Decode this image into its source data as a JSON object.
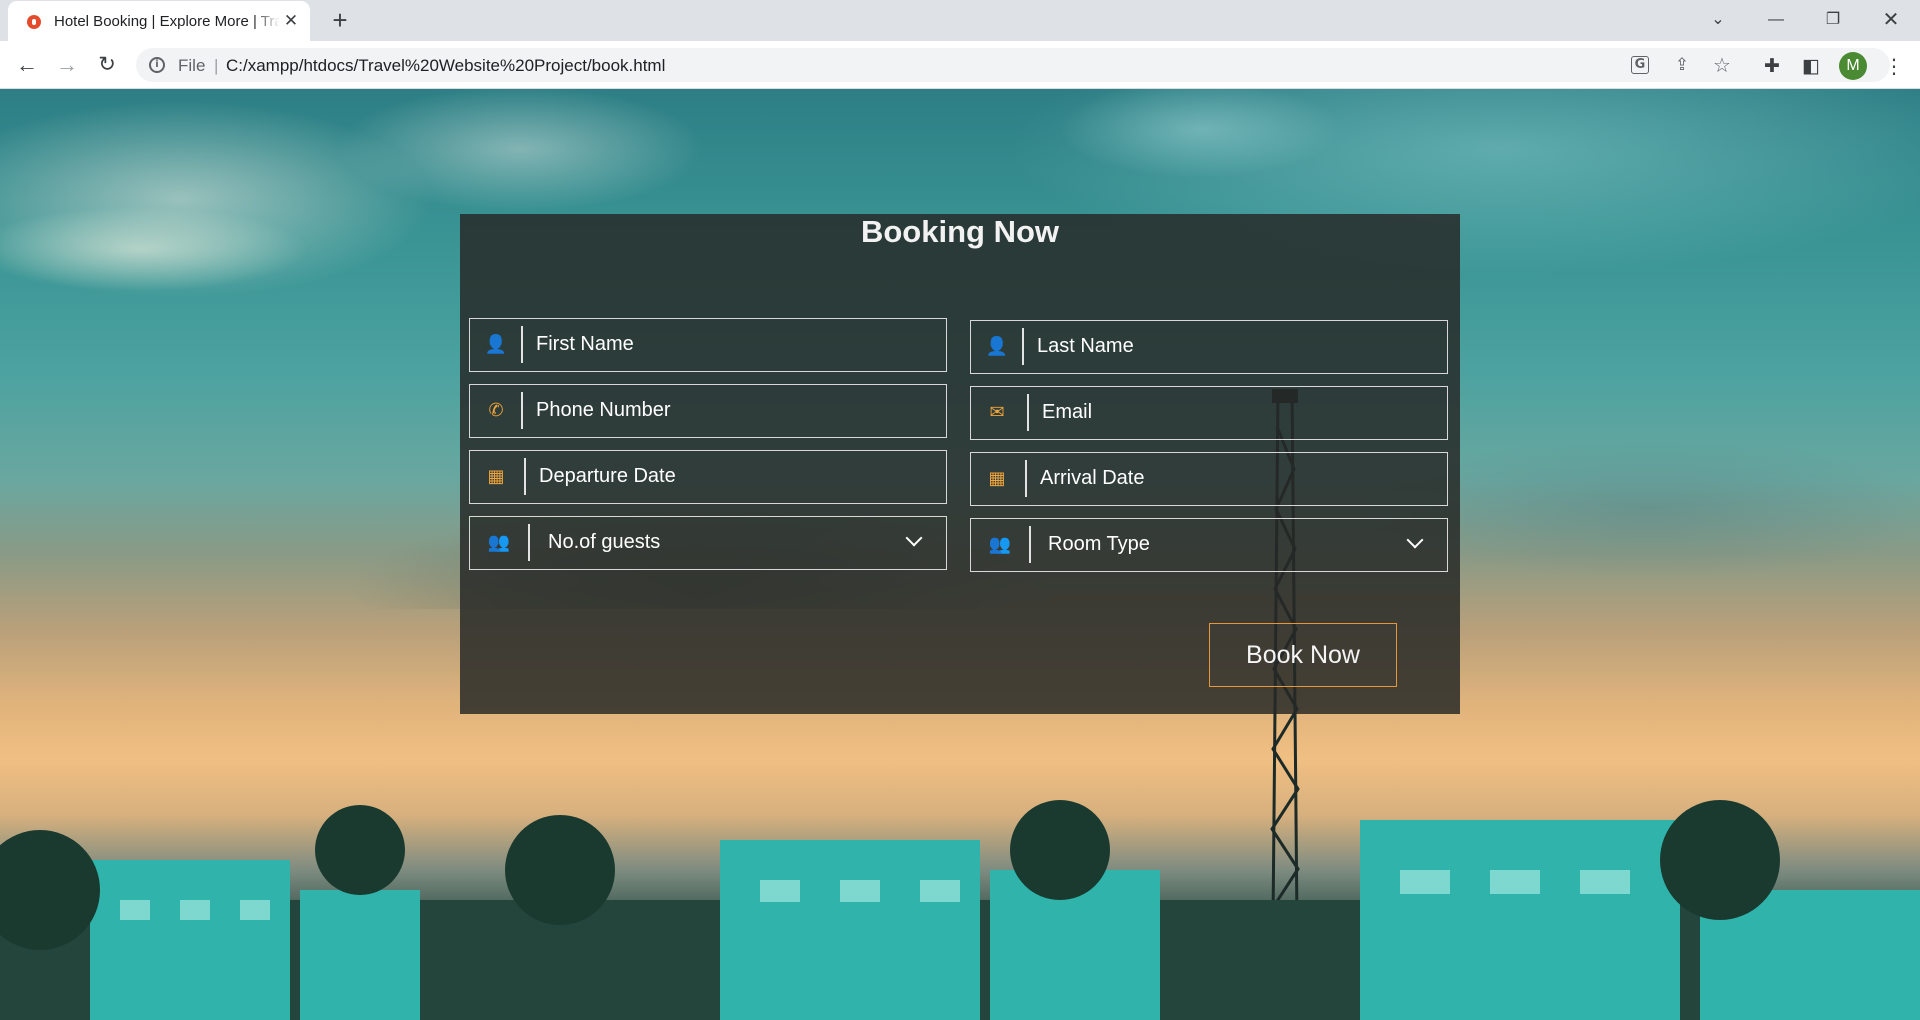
{
  "browser": {
    "tab_title": "Hotel Booking | Explore More | Travel",
    "tab_close": "✕",
    "new_tab": "+",
    "scheme": "File",
    "url": "C:/xampp/htdocs/Travel%20Website%20Project/book.html",
    "profile_initial": "M",
    "icons": [
      "back-icon",
      "forward-icon",
      "reload-icon",
      "info-icon",
      "translate-icon",
      "share-icon",
      "bookmark-star-icon",
      "extensions-icon",
      "side-panel-icon",
      "menu-icon"
    ]
  },
  "booking": {
    "title": "Booking Now",
    "fields": {
      "first_name": {
        "placeholder": "First Name",
        "icon": "user-icon"
      },
      "last_name": {
        "placeholder": "Last Name",
        "icon": "user-icon"
      },
      "phone": {
        "placeholder": "Phone Number",
        "icon": "phone-icon"
      },
      "email": {
        "placeholder": "Email",
        "icon": "envelope-icon"
      },
      "departure": {
        "placeholder": "Departure Date",
        "icon": "calendar-icon"
      },
      "arrival": {
        "placeholder": "Arrival Date",
        "icon": "calendar-icon"
      },
      "guests": {
        "selected": "No.of guests",
        "icon": "users-icon"
      },
      "room_type": {
        "selected": "Room Type",
        "icon": "users-icon"
      }
    },
    "submit_label": "Book Now",
    "colors": {
      "accent": "#f0a43a",
      "panel": "#262826",
      "field_border": "#d8d8d8",
      "button_border": "#e8963a"
    }
  }
}
